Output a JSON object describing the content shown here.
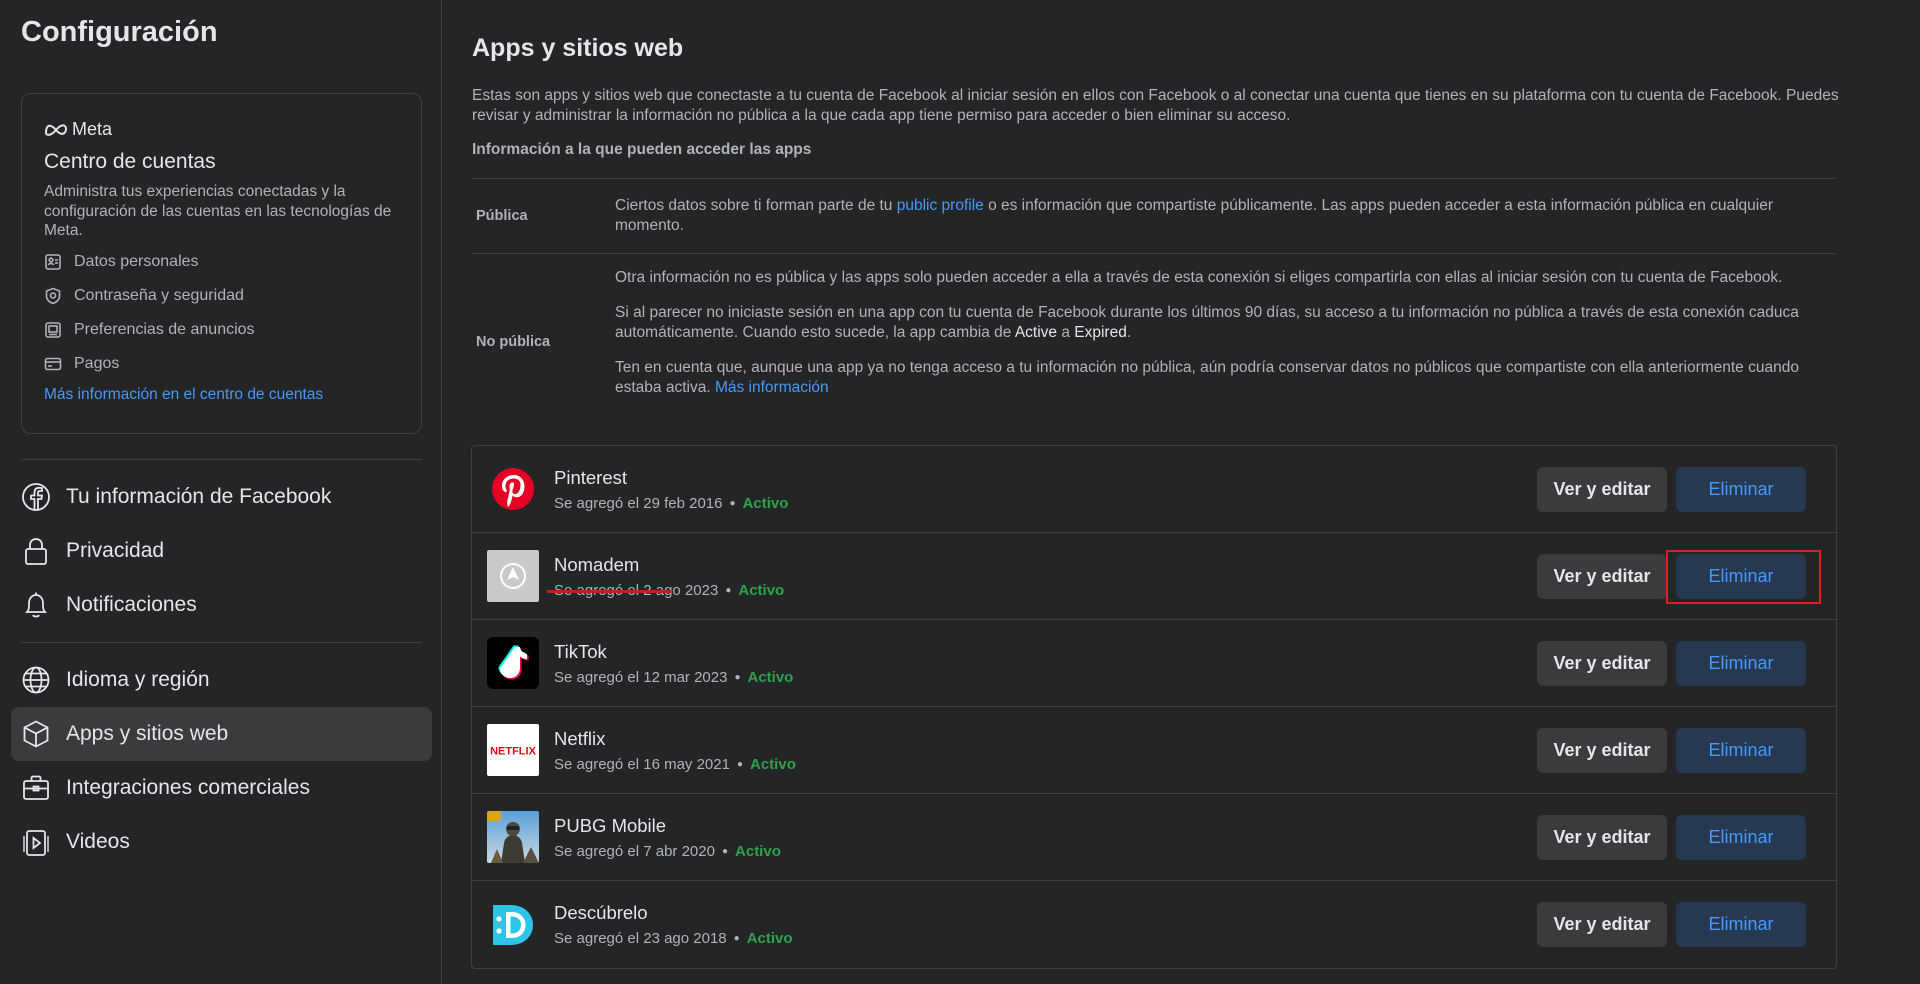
{
  "sidebar": {
    "title": "Configuración",
    "accounts_center": {
      "brand": "Meta",
      "title": "Centro de cuentas",
      "description": "Administra tus experiencias conectadas y la configuración de las cuentas en las tecnologías de Meta.",
      "items": [
        {
          "label": "Datos personales",
          "icon": "id-card-icon"
        },
        {
          "label": "Contraseña y seguridad",
          "icon": "shield-icon"
        },
        {
          "label": "Preferencias de anuncios",
          "icon": "ad-monitor-icon"
        },
        {
          "label": "Pagos",
          "icon": "credit-card-icon"
        }
      ],
      "link": "Más información en el centro de cuentas"
    },
    "nav": [
      {
        "label": "Tu información de Facebook",
        "icon": "facebook-icon"
      },
      {
        "label": "Privacidad",
        "icon": "lock-icon"
      },
      {
        "label": "Notificaciones",
        "icon": "bell-icon"
      },
      {
        "label": "Idioma y región",
        "icon": "globe-icon"
      },
      {
        "label": "Apps y sitios web",
        "icon": "cube-icon",
        "active": true
      },
      {
        "label": "Integraciones comerciales",
        "icon": "briefcase-icon"
      },
      {
        "label": "Videos",
        "icon": "video-icon"
      }
    ]
  },
  "main": {
    "title": "Apps y sitios web",
    "intro": "Estas son apps y sitios web que conectaste a tu cuenta de Facebook al iniciar sesión en ellos con Facebook o al conectar una cuenta que tienes en su plataforma con tu cuenta de Facebook. Puedes revisar y administrar la información no pública a la que cada app tiene permiso para acceder o bien eliminar su acceso.",
    "access_heading": "Información a la que pueden acceder las apps",
    "public": {
      "label": "Pública",
      "text_before": "Ciertos datos sobre ti forman parte de tu ",
      "link": "public profile",
      "text_after": " o es información que compartiste públicamente. Las apps pueden acceder a esta información pública en cualquier momento."
    },
    "non_public": {
      "label": "No pública",
      "p1": "Otra información no es pública y las apps solo pueden acceder a ella a través de esta conexión si eliges compartirla con ellas al iniciar sesión con tu cuenta de Facebook.",
      "p2_before": "Si al parecer no iniciaste sesión en una app con tu cuenta de Facebook durante los últimos 90 días, su acceso a tu información no pública a través de esta conexión caduca automáticamente. Cuando esto sucede, la app cambia de ",
      "p2_active": "Active",
      "p2_mid": " a ",
      "p2_expired": "Expired",
      "p2_end": ".",
      "p3": "Ten en cuenta que, aunque una app ya no tenga acceso a tu información no pública, aún podría conservar datos no públicos que compartiste con ella anteriormente cuando estaba activa. ",
      "p3_link": "Más información"
    },
    "buttons": {
      "edit": "Ver y editar",
      "remove": "Eliminar"
    },
    "apps": [
      {
        "name": "Pinterest",
        "added": "Se agregó el 29 feb 2016",
        "status": "Activo",
        "icon": "pinterest-icon"
      },
      {
        "name": "Nomadem",
        "added": "Se agregó el 2 ago 2023",
        "status": "Activo",
        "icon": "nomadem-icon"
      },
      {
        "name": "TikTok",
        "added": "Se agregó el 12 mar 2023",
        "status": "Activo",
        "icon": "tiktok-icon"
      },
      {
        "name": "Netflix",
        "added": "Se agregó el 16 may 2021",
        "status": "Activo",
        "icon": "netflix-icon",
        "icon_text": "NETFLIX"
      },
      {
        "name": "PUBG Mobile",
        "added": "Se agregó el 7 abr 2020",
        "status": "Activo",
        "icon": "pubg-icon"
      },
      {
        "name": "Descúbrelo",
        "added": "Se agregó el 23 ago 2018",
        "status": "Activo",
        "icon": "descubrelo-icon"
      }
    ]
  },
  "colors": {
    "accent": "#4599ff",
    "active_status": "#31a24c",
    "highlight": "#e41e1e"
  }
}
